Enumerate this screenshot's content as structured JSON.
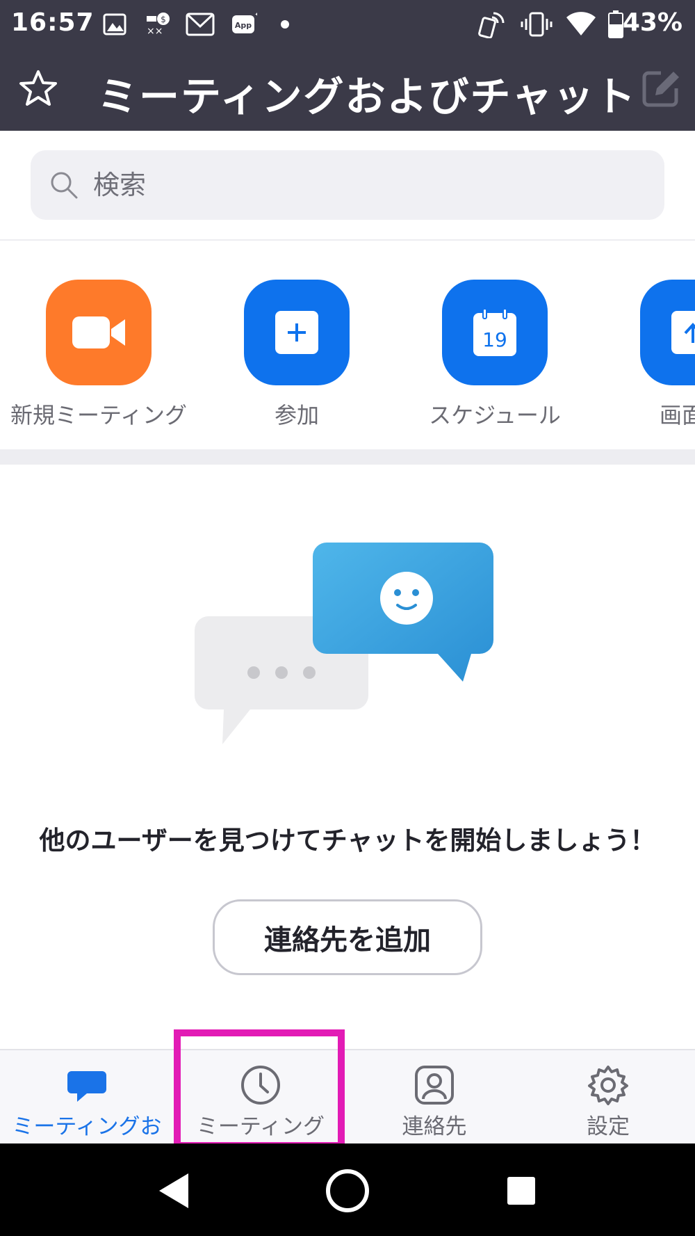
{
  "status_bar": {
    "time": "16:57",
    "battery": "43%",
    "icons": [
      "image-icon",
      "dollar-notification-icon",
      "gmail-icon",
      "app-icon",
      "dot-icon",
      "nfc-icon",
      "vibrate-icon",
      "wifi-icon",
      "battery-icon"
    ]
  },
  "header": {
    "title": "ミーティングおよびチャット"
  },
  "search": {
    "placeholder": "検索"
  },
  "quick_actions": [
    {
      "label": "新規ミーティング",
      "color": "#fe7a2a",
      "icon": "video-camera-icon"
    },
    {
      "label": "参加",
      "color": "#0e72ed",
      "icon": "plus-icon"
    },
    {
      "label": "スケジュール",
      "color": "#0e72ed",
      "icon": "calendar-icon",
      "calendar_day": "19"
    },
    {
      "label": "画面の",
      "color": "#0e72ed",
      "icon": "share-screen-icon"
    }
  ],
  "empty_state": {
    "message": "他のユーザーを見つけてチャットを開始しましょう！",
    "button": "連絡先を追加"
  },
  "tabs": [
    {
      "label": "ミーティングお",
      "icon": "chat-bubble-icon",
      "active": true
    },
    {
      "label": "ミーティング",
      "icon": "clock-icon",
      "active": false
    },
    {
      "label": "連絡先",
      "icon": "contact-icon",
      "active": false
    },
    {
      "label": "設定",
      "icon": "gear-icon",
      "active": false
    }
  ],
  "colors": {
    "header_bg": "#3b3a48",
    "accent_blue": "#0e72ed",
    "accent_orange": "#fe7a2a",
    "highlight_magenta": "#e21bb5"
  }
}
